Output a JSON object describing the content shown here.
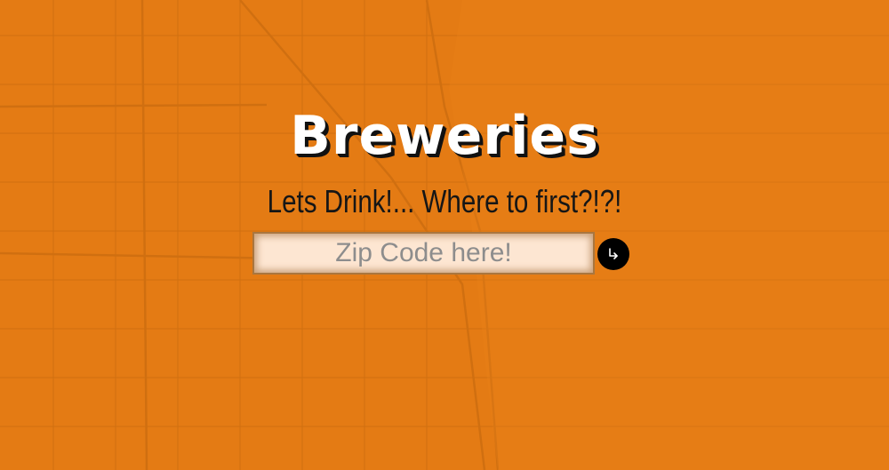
{
  "page": {
    "title": "Breweries",
    "subtitle": "Lets Drink!... Where to first?!?!"
  },
  "search": {
    "placeholder": "Zip Code here!",
    "value": "",
    "submit_icon": "enter-arrow-icon"
  },
  "colors": {
    "background": "#e47b14",
    "title_text": "#ffffff",
    "title_shadow": "#111111",
    "subtitle_text": "#161616",
    "input_background": "#fde6d2",
    "submit_button": "#000000"
  },
  "background": {
    "type": "street-map"
  }
}
